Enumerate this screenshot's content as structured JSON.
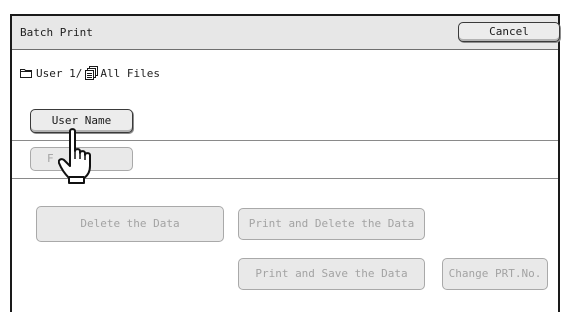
{
  "window": {
    "title": "Batch Print",
    "cancel_label": "Cancel"
  },
  "breadcrumb": {
    "icon": "folder-icon",
    "folder": "User 1/",
    "files_icon": "files-icon",
    "files": "All Files"
  },
  "sort_options": [
    {
      "label": "User Name",
      "state": "enabled"
    },
    {
      "label": "F",
      "state": "disabled"
    }
  ],
  "actions": {
    "delete_label": "Delete the Data",
    "print_delete_label": "Print and Delete the Data",
    "print_save_label": "Print and Save the Data",
    "change_prt_label": "Change PRT.No.",
    "state": "disabled"
  },
  "cursor": {
    "icon": "hand-pointer-icon"
  }
}
